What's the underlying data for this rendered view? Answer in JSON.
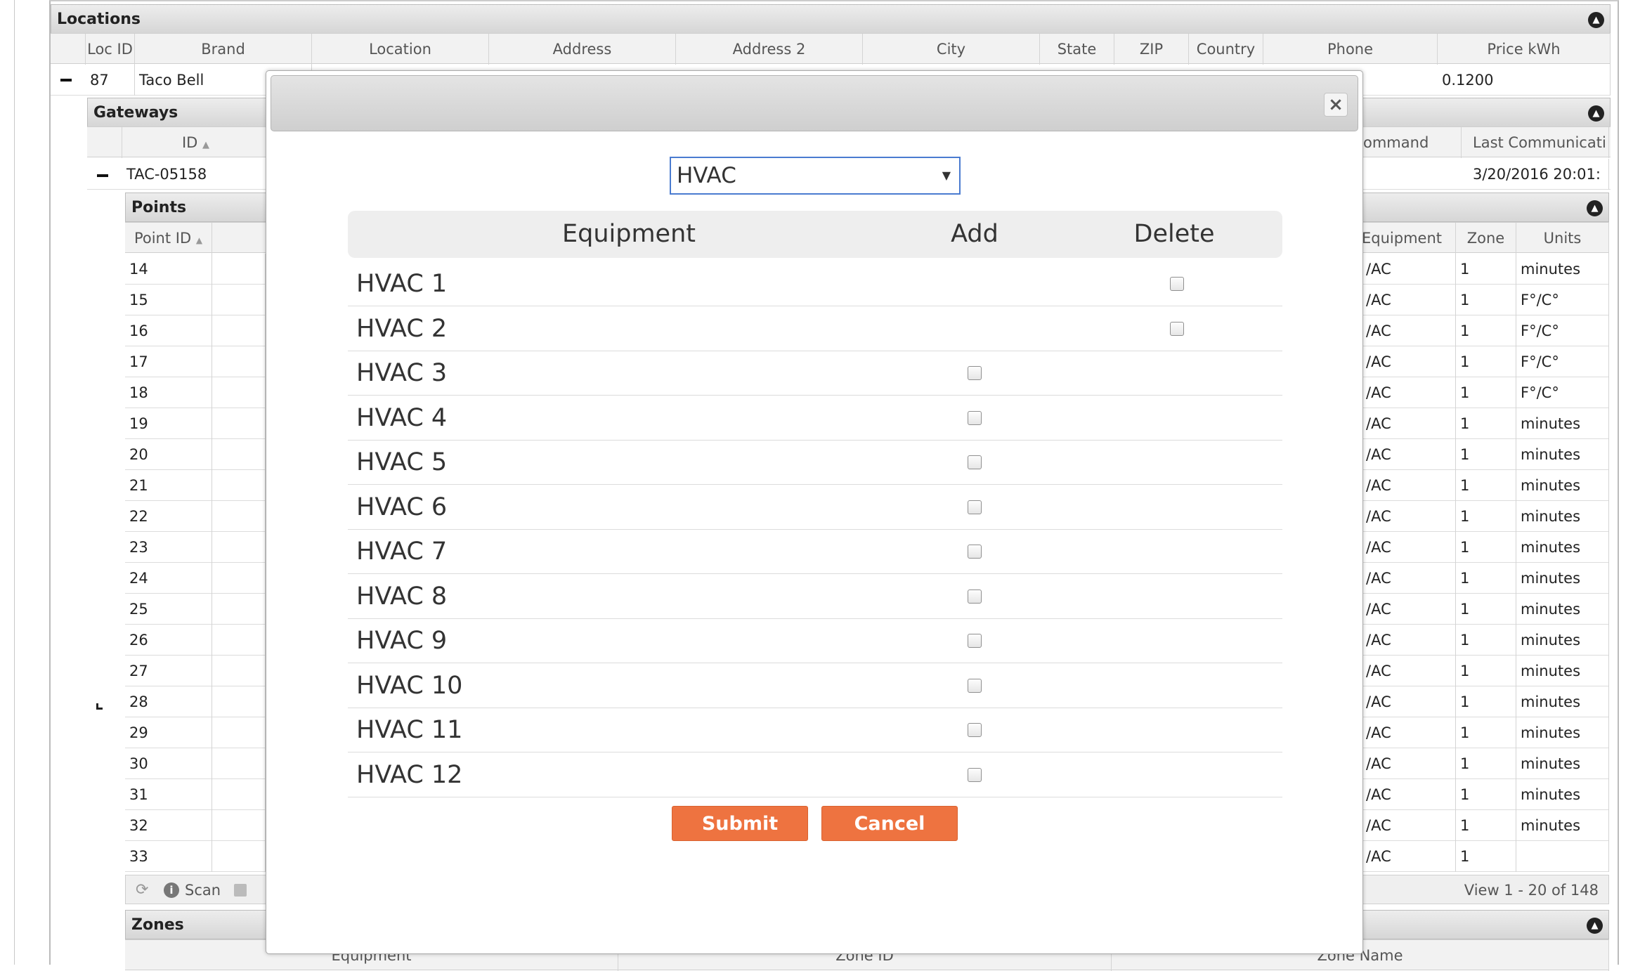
{
  "locations": {
    "title": "Locations",
    "columns": [
      "Loc ID",
      "Brand",
      "Location",
      "Address",
      "Address 2",
      "City",
      "State",
      "ZIP",
      "Country",
      "Phone",
      "Price kWh"
    ],
    "row": {
      "loc_id": "87",
      "brand": "Taco Bell",
      "price_kwh": "0.1200"
    }
  },
  "gateways": {
    "title": "Gateways",
    "id_header": "ID",
    "command_header": "ommand",
    "last_comm_header": "Last Communicati",
    "row": {
      "id": "TAC-05158",
      "last_comm": "3/20/2016 20:01:"
    }
  },
  "points": {
    "title": "Points",
    "point_id_header": "Point ID",
    "equipment_header": "Equipment",
    "zone_header": "Zone",
    "units_header": "Units",
    "rows": [
      {
        "id": "14",
        "eq": "/AC",
        "zone": "1",
        "units": "minutes"
      },
      {
        "id": "15",
        "eq": "/AC",
        "zone": "1",
        "units": "F°/C°"
      },
      {
        "id": "16",
        "eq": "/AC",
        "zone": "1",
        "units": "F°/C°"
      },
      {
        "id": "17",
        "eq": "/AC",
        "zone": "1",
        "units": "F°/C°"
      },
      {
        "id": "18",
        "eq": "/AC",
        "zone": "1",
        "units": "F°/C°"
      },
      {
        "id": "19",
        "eq": "/AC",
        "zone": "1",
        "units": "minutes"
      },
      {
        "id": "20",
        "eq": "/AC",
        "zone": "1",
        "units": "minutes"
      },
      {
        "id": "21",
        "eq": "/AC",
        "zone": "1",
        "units": "minutes"
      },
      {
        "id": "22",
        "eq": "/AC",
        "zone": "1",
        "units": "minutes"
      },
      {
        "id": "23",
        "eq": "/AC",
        "zone": "1",
        "units": "minutes"
      },
      {
        "id": "24",
        "eq": "/AC",
        "zone": "1",
        "units": "minutes"
      },
      {
        "id": "25",
        "eq": "/AC",
        "zone": "1",
        "units": "minutes"
      },
      {
        "id": "26",
        "eq": "/AC",
        "zone": "1",
        "units": "minutes"
      },
      {
        "id": "27",
        "eq": "/AC",
        "zone": "1",
        "units": "minutes"
      },
      {
        "id": "28",
        "eq": "/AC",
        "zone": "1",
        "units": "minutes"
      },
      {
        "id": "29",
        "eq": "/AC",
        "zone": "1",
        "units": "minutes"
      },
      {
        "id": "30",
        "eq": "/AC",
        "zone": "1",
        "units": "minutes"
      },
      {
        "id": "31",
        "eq": "/AC",
        "zone": "1",
        "units": "minutes"
      },
      {
        "id": "32",
        "eq": "/AC",
        "zone": "1",
        "units": "minutes"
      },
      {
        "id": "33",
        "eq": "/AC",
        "zone": "1",
        "units": ""
      }
    ],
    "pager": {
      "scan_label": "Scan",
      "view_text": "View 1 - 20 of 148"
    }
  },
  "zones": {
    "title": "Zones",
    "columns": [
      "Equipment",
      "Zone ID",
      "Zone Name"
    ]
  },
  "modal": {
    "select_value": "HVAC",
    "table_headers": {
      "equipment": "Equipment",
      "add": "Add",
      "delete": "Delete"
    },
    "equipment": [
      {
        "name": "HVAC 1",
        "action": "delete"
      },
      {
        "name": "HVAC 2",
        "action": "delete"
      },
      {
        "name": "HVAC 3",
        "action": "add"
      },
      {
        "name": "HVAC 4",
        "action": "add"
      },
      {
        "name": "HVAC 5",
        "action": "add"
      },
      {
        "name": "HVAC 6",
        "action": "add"
      },
      {
        "name": "HVAC 7",
        "action": "add"
      },
      {
        "name": "HVAC 8",
        "action": "add"
      },
      {
        "name": "HVAC 9",
        "action": "add"
      },
      {
        "name": "HVAC 10",
        "action": "add"
      },
      {
        "name": "HVAC 11",
        "action": "add"
      },
      {
        "name": "HVAC 12",
        "action": "add"
      }
    ],
    "submit_label": "Submit",
    "cancel_label": "Cancel",
    "close_icon": "close-icon"
  },
  "colors": {
    "accent_button": "#ee7340",
    "select_border": "#4a7bd0",
    "header_bg": "#eeeeee"
  }
}
